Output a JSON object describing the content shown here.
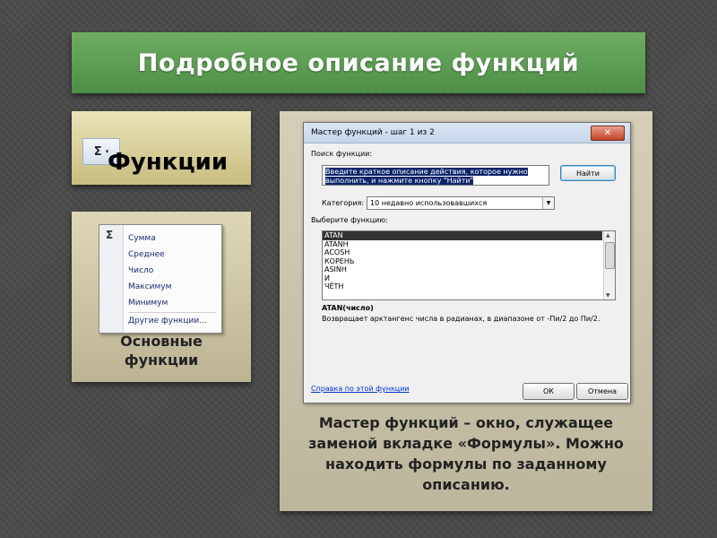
{
  "title": "Подробное описание функций",
  "functions_panel": {
    "label": "Функции",
    "sigma": "Σ",
    "arrow": "▾"
  },
  "basic_panel": {
    "menu_sigma": "Σ",
    "menu_items": [
      "Сумма",
      "Среднее",
      "Число",
      "Максимум",
      "Минимум"
    ],
    "menu_other": "Другие функции...",
    "label": "Основные\nфункции"
  },
  "dialog": {
    "title": "Мастер функций - шаг 1 из 2",
    "close": "✕",
    "search_label": "Поиск функции:",
    "search_value_line1": "Введите краткое описание действия, которое нужно",
    "search_value_line2": "выполнить, и нажмите кнопку \"Найти\"",
    "find_button": "Найти",
    "category_label": "Категория:",
    "category_value": "10 недавно использовавшихся",
    "select_label": "Выберите функцию:",
    "functions": [
      "ATAN",
      "ATANH",
      "ACOSH",
      "КОРЕНЬ",
      "ASINH",
      "И",
      "ЧЁТН"
    ],
    "selected_function": "ATAN",
    "signature": "ATAN(число)",
    "description": "Возвращает арктангенс числа в радианах, в диапазоне от -Пи/2 до Пи/2.",
    "help_link": "Справка по этой функции",
    "ok": "ОК",
    "cancel": "Отмена"
  },
  "caption": "Мастер функций – окно, служащее заменой вкладке «Формулы». Можно находить формулы по заданному описанию."
}
